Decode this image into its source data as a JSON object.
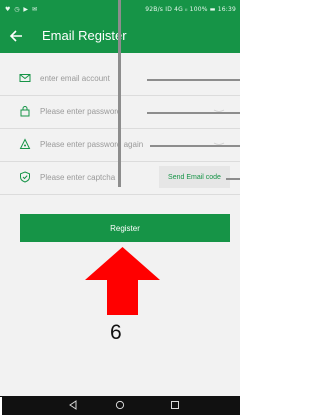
{
  "status_bar": {
    "left_icons": "♥ ◷ ▶ ✉",
    "right_text": "92B/s ID 4G ᵢₗ 100% ▬ 16:39"
  },
  "header": {
    "back_icon": "arrow-left-icon",
    "title": "Email Register"
  },
  "form": {
    "email": {
      "icon": "mail-icon",
      "placeholder": "enter email account"
    },
    "password": {
      "icon": "lock-icon",
      "placeholder": "Please enter password"
    },
    "password_again": {
      "icon": "lock-open-icon",
      "placeholder": "Please enter password again"
    },
    "captcha": {
      "icon": "shield-check-icon",
      "placeholder": "Please enter captcha",
      "send_button": "Send Email code"
    }
  },
  "register_button": "Register",
  "annotation": {
    "marker": "6",
    "arrow_color": "#ff0000"
  },
  "colors": {
    "brand_green": "#169447",
    "background": "#f2f2f2"
  }
}
